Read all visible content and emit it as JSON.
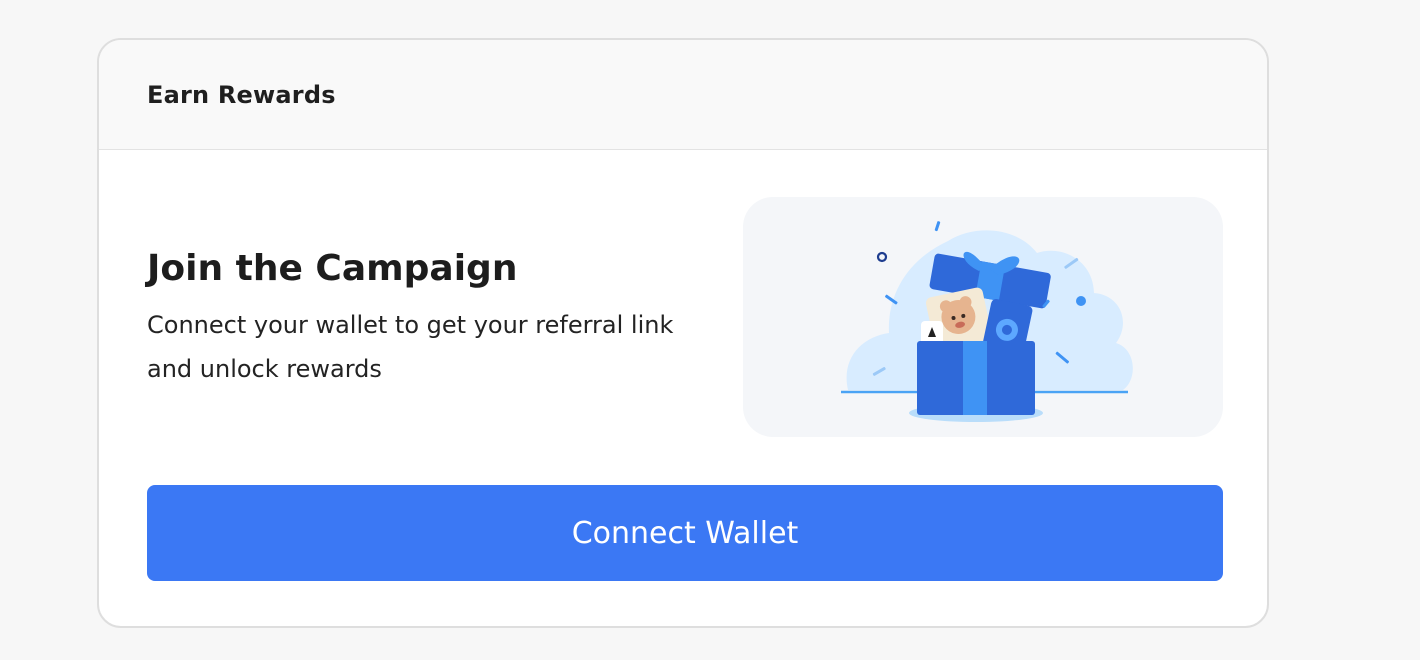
{
  "card": {
    "header_title": "Earn Rewards"
  },
  "campaign": {
    "heading": "Join the Campaign",
    "description": "Connect your wallet to get your referral link and unlock rewards"
  },
  "illustration": {
    "icon": "gift-box-illustration"
  },
  "actions": {
    "connect_label": "Connect Wallet"
  },
  "colors": {
    "accent": "#3b78f4",
    "gift_blue": "#2f69d9",
    "cloud": "#d8ecff"
  }
}
